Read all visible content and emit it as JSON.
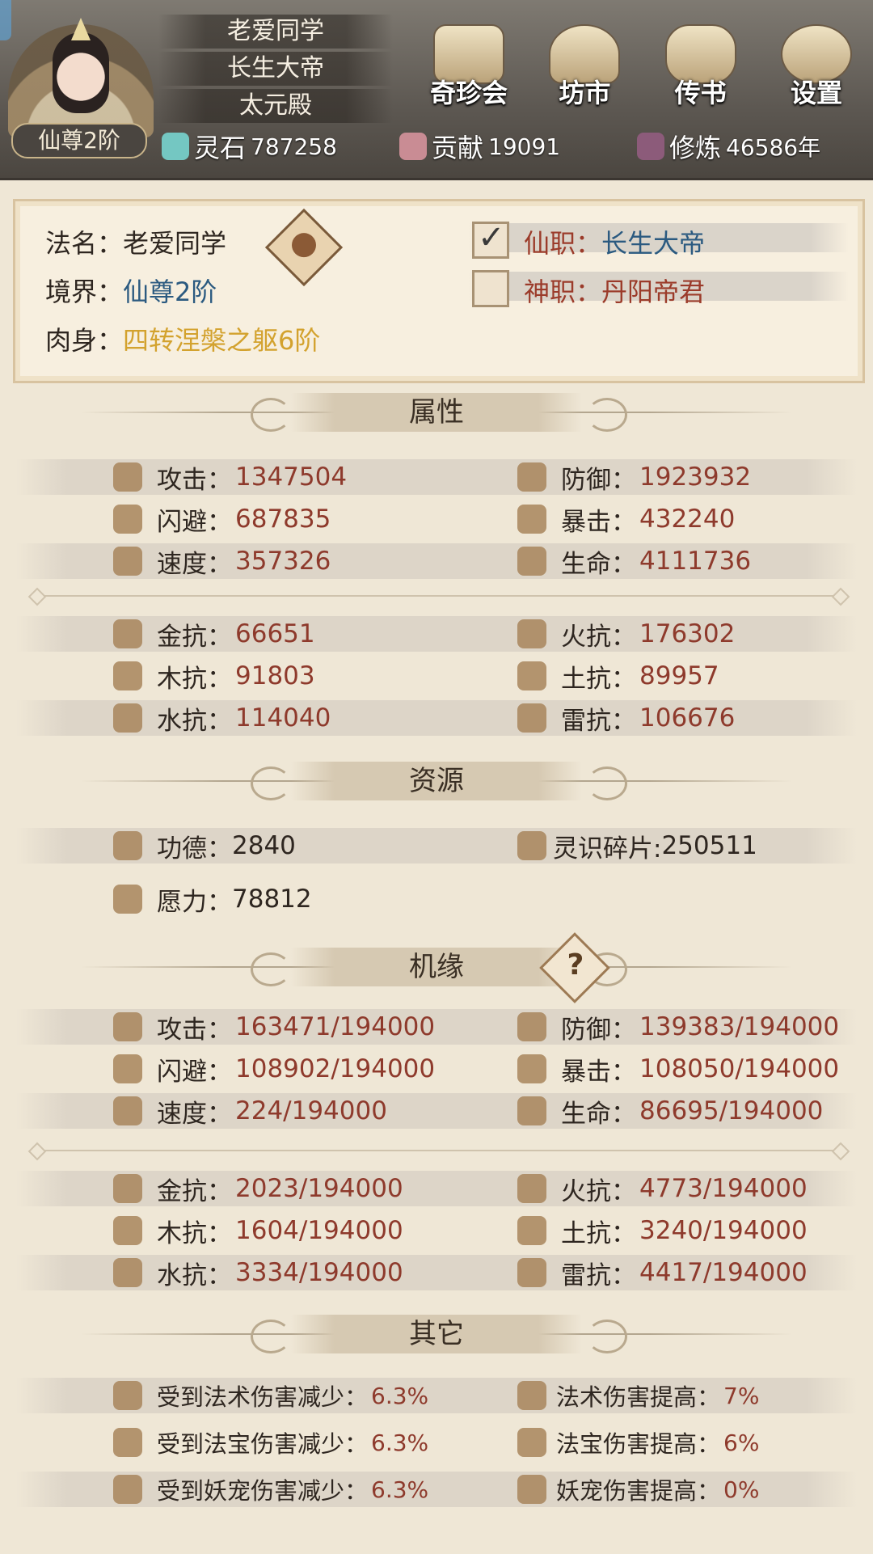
{
  "header": {
    "player_name": "老爱同学",
    "title": "长生大帝",
    "palace": "太元殿",
    "rank": "仙尊2阶",
    "nav": [
      {
        "label": "奇珍会",
        "icon": "pavilion-icon"
      },
      {
        "label": "坊市",
        "icon": "market-icon"
      },
      {
        "label": "传书",
        "icon": "scroll-icon"
      },
      {
        "label": "设置",
        "icon": "gear-icon"
      }
    ],
    "resources": [
      {
        "label": "灵石",
        "value": "787258",
        "icon": "spirit-stone-icon"
      },
      {
        "label": "贡献",
        "value": "19091",
        "icon": "contribution-icon"
      },
      {
        "label": "修炼",
        "value": "46586年",
        "icon": "cultivation-icon"
      }
    ]
  },
  "profile": {
    "name_label": "法名：",
    "name_value": "老爱同学",
    "realm_label": "境界：",
    "realm_value": "仙尊2阶",
    "body_label": "肉身：",
    "body_value": "四转涅槃之躯6阶",
    "immortal_post_label": "仙职：",
    "immortal_post_value": "长生大帝",
    "divine_post_label": "神职：",
    "divine_post_value": "丹阳帝君"
  },
  "sections": {
    "attributes": "属性",
    "resources": "资源",
    "fortune": "机缘",
    "other": "其它"
  },
  "attributes": {
    "combat": [
      {
        "left": {
          "label": "攻击：",
          "value": "1347504",
          "icon": "attack-icon"
        },
        "right": {
          "label": "防御：",
          "value": "1923932",
          "icon": "defense-icon"
        }
      },
      {
        "left": {
          "label": "闪避：",
          "value": "687835",
          "icon": "dodge-icon"
        },
        "right": {
          "label": "暴击：",
          "value": "432240",
          "icon": "crit-icon"
        }
      },
      {
        "left": {
          "label": "速度：",
          "value": "357326",
          "icon": "speed-icon"
        },
        "right": {
          "label": "生命：",
          "value": "4111736",
          "icon": "life-icon"
        }
      }
    ],
    "resist": [
      {
        "left": {
          "label": "金抗：",
          "value": "66651",
          "icon": "metal-resist-icon"
        },
        "right": {
          "label": "火抗：",
          "value": "176302",
          "icon": "fire-resist-icon"
        }
      },
      {
        "left": {
          "label": "木抗：",
          "value": "91803",
          "icon": "wood-resist-icon"
        },
        "right": {
          "label": "土抗：",
          "value": "89957",
          "icon": "earth-resist-icon"
        }
      },
      {
        "left": {
          "label": "水抗：",
          "value": "114040",
          "icon": "water-resist-icon"
        },
        "right": {
          "label": "雷抗：",
          "value": "106676",
          "icon": "thunder-resist-icon"
        }
      }
    ]
  },
  "resources": {
    "merit_label": "功德：",
    "merit_value": "2840",
    "shard_label": "灵识碎片:",
    "shard_value": "250511",
    "willpower_label": "愿力：",
    "willpower_value": "78812"
  },
  "fortune": {
    "help_icon": "question-icon",
    "combat": [
      {
        "left": {
          "label": "攻击：",
          "value": "163471/194000"
        },
        "right": {
          "label": "防御：",
          "value": "139383/194000"
        }
      },
      {
        "left": {
          "label": "闪避：",
          "value": "108902/194000"
        },
        "right": {
          "label": "暴击：",
          "value": "108050/194000"
        }
      },
      {
        "left": {
          "label": "速度：",
          "value": "224/194000"
        },
        "right": {
          "label": "生命：",
          "value": "86695/194000"
        }
      }
    ],
    "resist": [
      {
        "left": {
          "label": "金抗：",
          "value": "2023/194000"
        },
        "right": {
          "label": "火抗：",
          "value": "4773/194000"
        }
      },
      {
        "left": {
          "label": "木抗：",
          "value": "1604/194000"
        },
        "right": {
          "label": "土抗：",
          "value": "3240/194000"
        }
      },
      {
        "left": {
          "label": "水抗：",
          "value": "3334/194000"
        },
        "right": {
          "label": "雷抗：",
          "value": "4417/194000"
        }
      }
    ]
  },
  "other": [
    {
      "left": {
        "label": "受到法术伤害减少：",
        "value": "6.3%"
      },
      "right": {
        "label": "法术伤害提高：",
        "value": "7%"
      }
    },
    {
      "left": {
        "label": "受到法宝伤害减少：",
        "value": "6.3%"
      },
      "right": {
        "label": "法宝伤害提高：",
        "value": "6%"
      }
    },
    {
      "left": {
        "label": "受到妖宠伤害减少：",
        "value": "6.3%"
      },
      "right": {
        "label": "妖宠伤害提高：",
        "value": "0%"
      }
    }
  ],
  "colors": {
    "value_red": "#8e3a2c",
    "value_blue": "#2b5a80",
    "value_gold": "#d3a22e",
    "background": "#efe7d6"
  }
}
